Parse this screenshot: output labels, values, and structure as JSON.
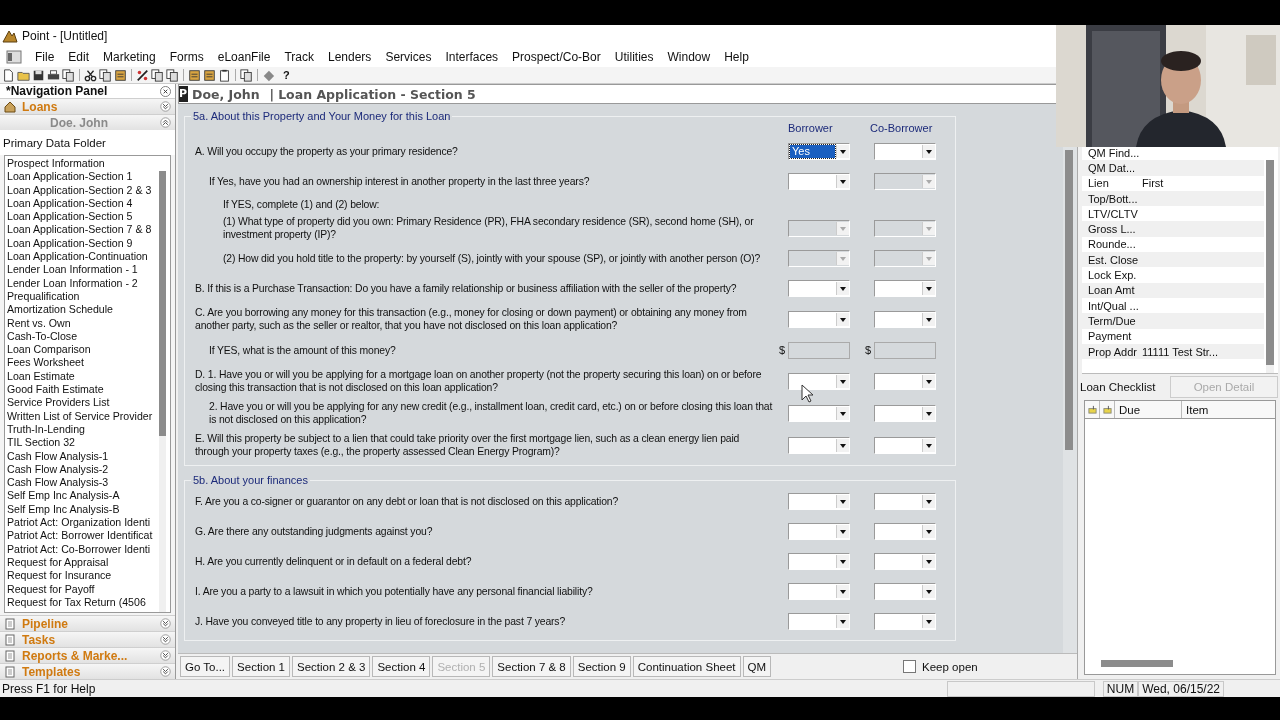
{
  "window": {
    "title": "Point - [Untitled]"
  },
  "menu": [
    "File",
    "Edit",
    "Marketing",
    "Forms",
    "eLoanFile",
    "Track",
    "Lenders",
    "Services",
    "Interfaces",
    "Prospect/Co-Bor",
    "Utilities",
    "Window",
    "Help"
  ],
  "toolbar": {
    "help": "?"
  },
  "nav": {
    "title": "*Navigation Panel",
    "loans": "Loans",
    "borrower": "Doe. John",
    "folder": "Primary Data Folder",
    "items": [
      "Prospect Information",
      "Loan Application-Section 1",
      "Loan Application-Section 2 & 3",
      "Loan Application-Section 4",
      "Loan Application-Section 5",
      "Loan Application-Section 7 & 8",
      "Loan Application-Section 9",
      "Loan Application-Continuation",
      "Lender Loan Information - 1",
      "Lender Loan Information - 2",
      "Prequalification",
      "Amortization Schedule",
      "Rent vs. Own",
      "Cash-To-Close",
      "Loan Comparison",
      "Fees Worksheet",
      "Loan Estimate",
      "Good Faith Estimate",
      "Service Providers List",
      "Written List of Service Provider",
      "Truth-In-Lending",
      "TIL Section 32",
      "Cash Flow Analysis-1",
      "Cash Flow Analysis-2",
      "Cash Flow Analysis-3",
      "Self Emp Inc Analysis-A",
      "Self Emp Inc Analysis-B",
      "Patriot Act: Organization Identi",
      "Patriot Act: Borrower Identificat",
      "Patriot Act: Co-Borrower Identi",
      "Request for Appraisal",
      "Request for Insurance",
      "Request for Payoff",
      "Request for Tax Return (4506"
    ],
    "sections": [
      "Pipeline",
      "Tasks",
      "Reports & Marke...",
      "Templates"
    ]
  },
  "form": {
    "badge": "P",
    "client": "Doe, John",
    "separator": "|",
    "title": "Loan Application - Section 5",
    "columns": [
      "Borrower",
      "Co-Borrower"
    ],
    "sections": [
      {
        "legend": "5a. About this Property and Your Money for this Loan",
        "questions": [
          {
            "kind": "select",
            "text": "A. Will you occupy the property as your primary residence?",
            "borrower": {
              "value": "Yes",
              "focused": true,
              "disabled": false
            },
            "co_borrower": {
              "focused": false,
              "disabled": false
            },
            "children": [
              {
                "kind": "select",
                "text": "If Yes, have you had an ownership interest in another property in the last three years?",
                "borrower": {
                  "focused": false,
                  "disabled": false
                },
                "co_borrower": {
                  "focused": false,
                  "disabled": true
                },
                "children": [
                  {
                    "kind": "note",
                    "text": "If YES, complete (1) and (2) below:"
                  },
                  {
                    "kind": "select",
                    "text": "(1) What type of property did you own: Primary Residence (PR), FHA secondary residence (SR), second home (SH), or investment property (IP)?",
                    "borrower": {
                      "focused": false,
                      "disabled": true
                    },
                    "co_borrower": {
                      "focused": false,
                      "disabled": true
                    }
                  },
                  {
                    "kind": "select",
                    "text": "(2) How did you hold title to the property: by yourself (S), jointly with your spouse (SP), or jointly with another person (O)?",
                    "borrower": {
                      "focused": false,
                      "disabled": true
                    },
                    "co_borrower": {
                      "focused": false,
                      "disabled": true
                    }
                  }
                ]
              }
            ]
          },
          {
            "kind": "select",
            "text": "B. If this is a Purchase Transaction: Do you have a family relationship or business affiliation with the seller of the property?",
            "borrower": {
              "focused": false,
              "disabled": false
            },
            "co_borrower": {
              "focused": false,
              "disabled": false
            }
          },
          {
            "kind": "select",
            "text": "C. Are you borrowing any money for this transaction (e.g., money for closing or down payment) or obtaining any money from another party, such as the seller or realtor, that you have not disclosed on this loan application?",
            "borrower": {
              "focused": false,
              "disabled": false
            },
            "co_borrower": {
              "focused": false,
              "disabled": false
            },
            "children": [
              {
                "kind": "amount",
                "text": "If YES, what is the amount of this money?",
                "borrower": {
                  "currency": "$",
                  "disabled": true
                },
                "co_borrower": {
                  "currency": "$",
                  "disabled": true
                }
              }
            ]
          },
          {
            "kind": "select",
            "text": "D. 1. Have you or will you be applying for a mortgage loan on another property (not the property securing this loan) on or before closing this transaction that is not disclosed on this loan application?",
            "borrower": {
              "focused": false,
              "disabled": false
            },
            "co_borrower": {
              "focused": false,
              "disabled": false
            },
            "children": [
              {
                "kind": "select",
                "text": "2. Have you or will you be applying for any new credit (e.g., installment loan, credit card, etc.) on or before closing this loan that is not disclosed on this application?",
                "borrower": {
                  "focused": false,
                  "disabled": false
                },
                "co_borrower": {
                  "focused": false,
                  "disabled": false
                }
              }
            ]
          },
          {
            "kind": "select",
            "text": "E. Will this property be subject to a lien that could take priority over the first mortgage lien, such as a clean energy lien paid through your property taxes (e.g., the property assessed Clean Energy Program)?",
            "borrower": {
              "focused": false,
              "disabled": false
            },
            "co_borrower": {
              "focused": false,
              "disabled": false
            }
          }
        ]
      },
      {
        "legend": "5b. About your finances",
        "questions": [
          {
            "kind": "select",
            "text": "F. Are you a co-signer or guarantor on any debt or loan that is not disclosed on this application?",
            "borrower": {
              "focused": false,
              "disabled": false
            },
            "co_borrower": {
              "focused": false,
              "disabled": false
            }
          },
          {
            "kind": "select",
            "text": "G. Are there any outstanding judgments against you?",
            "borrower": {
              "focused": false,
              "disabled": false
            },
            "co_borrower": {
              "focused": false,
              "disabled": false
            }
          },
          {
            "kind": "select",
            "text": "H. Are you currently delinquent or in default on a federal debt?",
            "borrower": {
              "focused": false,
              "disabled": false
            },
            "co_borrower": {
              "focused": false,
              "disabled": false
            }
          },
          {
            "kind": "select",
            "text": "I. Are you a party to a lawsuit in which you potentially have any personal financial liability?",
            "borrower": {
              "focused": false,
              "disabled": false
            },
            "co_borrower": {
              "focused": false,
              "disabled": false
            }
          },
          {
            "kind": "select",
            "text": "J. Have you conveyed title to any property in lieu of foreclosure in the past 7 years?",
            "borrower": {
              "focused": false,
              "disabled": false
            },
            "co_borrower": {
              "focused": false,
              "disabled": false
            }
          }
        ]
      }
    ],
    "tabs": [
      {
        "label": "Go To...",
        "disabled": false
      },
      {
        "label": "Section 1",
        "disabled": false
      },
      {
        "label": "Section 2 & 3",
        "disabled": false
      },
      {
        "label": "Section 4",
        "disabled": false
      },
      {
        "label": "Section 5",
        "disabled": true
      },
      {
        "label": "Section 7 & 8",
        "disabled": false
      },
      {
        "label": "Section 9",
        "disabled": false
      },
      {
        "label": "Continuation Sheet",
        "disabled": false
      },
      {
        "label": "QM",
        "disabled": false
      }
    ],
    "keep_open": {
      "label": "Keep open",
      "checked": false
    }
  },
  "summary": [
    {
      "label": "QM Find..."
    },
    {
      "label": "QM Dat..."
    },
    {
      "label": "Lien",
      "value": "First"
    },
    {
      "label": "Top/Bott..."
    },
    {
      "label": "LTV/CLTV"
    },
    {
      "label": "Gross L..."
    },
    {
      "label": "Rounde..."
    },
    {
      "label": "Est. Close"
    },
    {
      "label": "Lock Exp."
    },
    {
      "label": "Loan Amt"
    },
    {
      "label": "Int/Qual ..."
    },
    {
      "label": "Term/Due"
    },
    {
      "label": "Payment"
    },
    {
      "label": "Prop Addr",
      "value": "11111 Test Str..."
    }
  ],
  "checklist": {
    "title": "Loan Checklist",
    "button": {
      "label": "Open Detail",
      "disabled": true
    },
    "columns": [
      "Due",
      "Item"
    ]
  },
  "status": {
    "help": "Press F1 for Help",
    "num": "NUM",
    "date": "Wed, 06/15/22"
  },
  "webcam": {
    "kind": "picture"
  }
}
